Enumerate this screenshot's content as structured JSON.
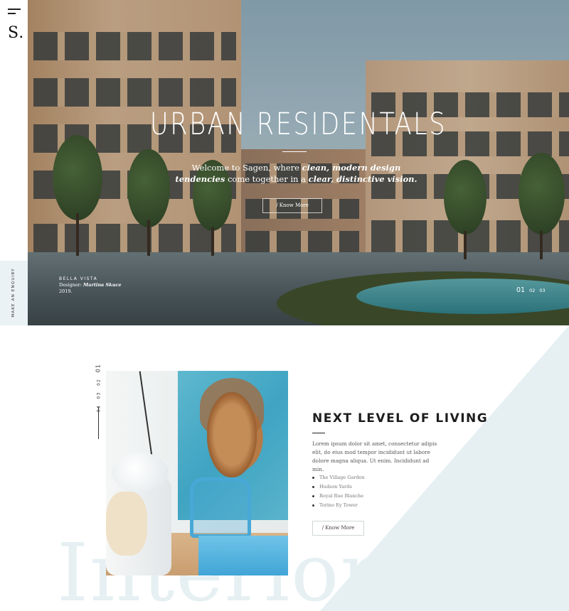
{
  "brand": {
    "logo": "S."
  },
  "rail": {
    "enquiry_label": "MAKE AN ENQUIRY"
  },
  "hero": {
    "title": "URBAN RESIDENTALS",
    "text_intro": "Welcome to Sagen, where ",
    "text_em1": "clean, modern design tendencies",
    "text_mid": " come together in a ",
    "text_em2": "clear, distinctive vision.",
    "button_label": "/ Know More",
    "caption_title": "BELLA VISTA",
    "caption_designer_label": "Designer: ",
    "caption_designer_name": "Martina Skuce",
    "caption_year": "2019.",
    "slides": [
      "01",
      "02",
      "03"
    ]
  },
  "section": {
    "slide_numbers": [
      "01",
      "02",
      "03",
      "04"
    ],
    "title": "NEXT LEVEL OF LIVING",
    "body": "Lorem ipsum dolor sit amet, consectetur adipis elit, do eius mod tempor incididunt ut labore dolore magna aliqua. Ut enim. Incididunt ad min.",
    "list": [
      "The Village Garden",
      "Hudson Yards",
      "Royal Rue Blanche",
      "Torino Ey Tower"
    ],
    "button_label": "/ Know More",
    "background_word": "Interiors"
  },
  "colors": {
    "accent_light": "#eaf2f5",
    "text_dark": "#1d1d1d",
    "pool": "#2f7d86"
  }
}
